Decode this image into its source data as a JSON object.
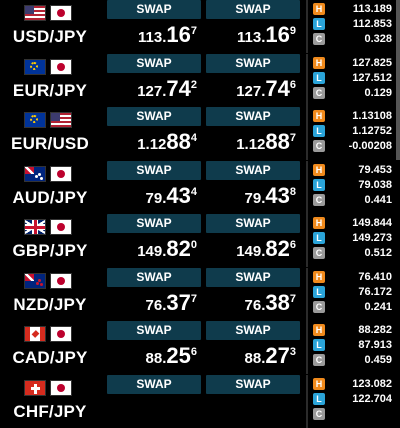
{
  "swap_label": "SWAP",
  "badges": {
    "high": "H",
    "low": "L",
    "change": "C"
  },
  "rows": [
    {
      "pair": "USD/JPY",
      "flags": [
        "us-flag-icon",
        "jp-flag-icon"
      ],
      "bid": {
        "main": "113.",
        "big": "16",
        "sup": "7"
      },
      "ask": {
        "main": "113.",
        "big": "16",
        "sup": "9"
      },
      "high": "113.189",
      "low": "112.853",
      "change": "0.328"
    },
    {
      "pair": "EUR/JPY",
      "flags": [
        "eu-flag-icon",
        "jp-flag-icon"
      ],
      "bid": {
        "main": "127.",
        "big": "74",
        "sup": "2"
      },
      "ask": {
        "main": "127.",
        "big": "74",
        "sup": "6"
      },
      "high": "127.825",
      "low": "127.512",
      "change": "0.129"
    },
    {
      "pair": "EUR/USD",
      "flags": [
        "eu-flag-icon",
        "us-flag-icon"
      ],
      "bid": {
        "main": "1.12",
        "big": "88",
        "sup": "4"
      },
      "ask": {
        "main": "1.12",
        "big": "88",
        "sup": "7"
      },
      "high": "1.13108",
      "low": "1.12752",
      "change": "-0.00208"
    },
    {
      "pair": "AUD/JPY",
      "flags": [
        "au-flag-icon",
        "jp-flag-icon"
      ],
      "bid": {
        "main": "79.",
        "big": "43",
        "sup": "4"
      },
      "ask": {
        "main": "79.",
        "big": "43",
        "sup": "8"
      },
      "high": "79.453",
      "low": "79.038",
      "change": "0.441"
    },
    {
      "pair": "GBP/JPY",
      "flags": [
        "gb-flag-icon",
        "jp-flag-icon"
      ],
      "bid": {
        "main": "149.",
        "big": "82",
        "sup": "0"
      },
      "ask": {
        "main": "149.",
        "big": "82",
        "sup": "6"
      },
      "high": "149.844",
      "low": "149.273",
      "change": "0.512"
    },
    {
      "pair": "NZD/JPY",
      "flags": [
        "nz-flag-icon",
        "jp-flag-icon"
      ],
      "bid": {
        "main": "76.",
        "big": "37",
        "sup": "7"
      },
      "ask": {
        "main": "76.",
        "big": "38",
        "sup": "7"
      },
      "high": "76.410",
      "low": "76.172",
      "change": "0.241"
    },
    {
      "pair": "CAD/JPY",
      "flags": [
        "ca-flag-icon",
        "jp-flag-icon"
      ],
      "bid": {
        "main": "88.",
        "big": "25",
        "sup": "6"
      },
      "ask": {
        "main": "88.",
        "big": "27",
        "sup": "3"
      },
      "high": "88.282",
      "low": "87.913",
      "change": "0.459"
    },
    {
      "pair": "CHF/JPY",
      "flags": [
        "ch-flag-icon",
        "jp-flag-icon"
      ],
      "bid": {
        "main": "",
        "big": "",
        "sup": ""
      },
      "ask": {
        "main": "",
        "big": "",
        "sup": ""
      },
      "high": "123.082",
      "low": "122.704",
      "change": ""
    }
  ]
}
